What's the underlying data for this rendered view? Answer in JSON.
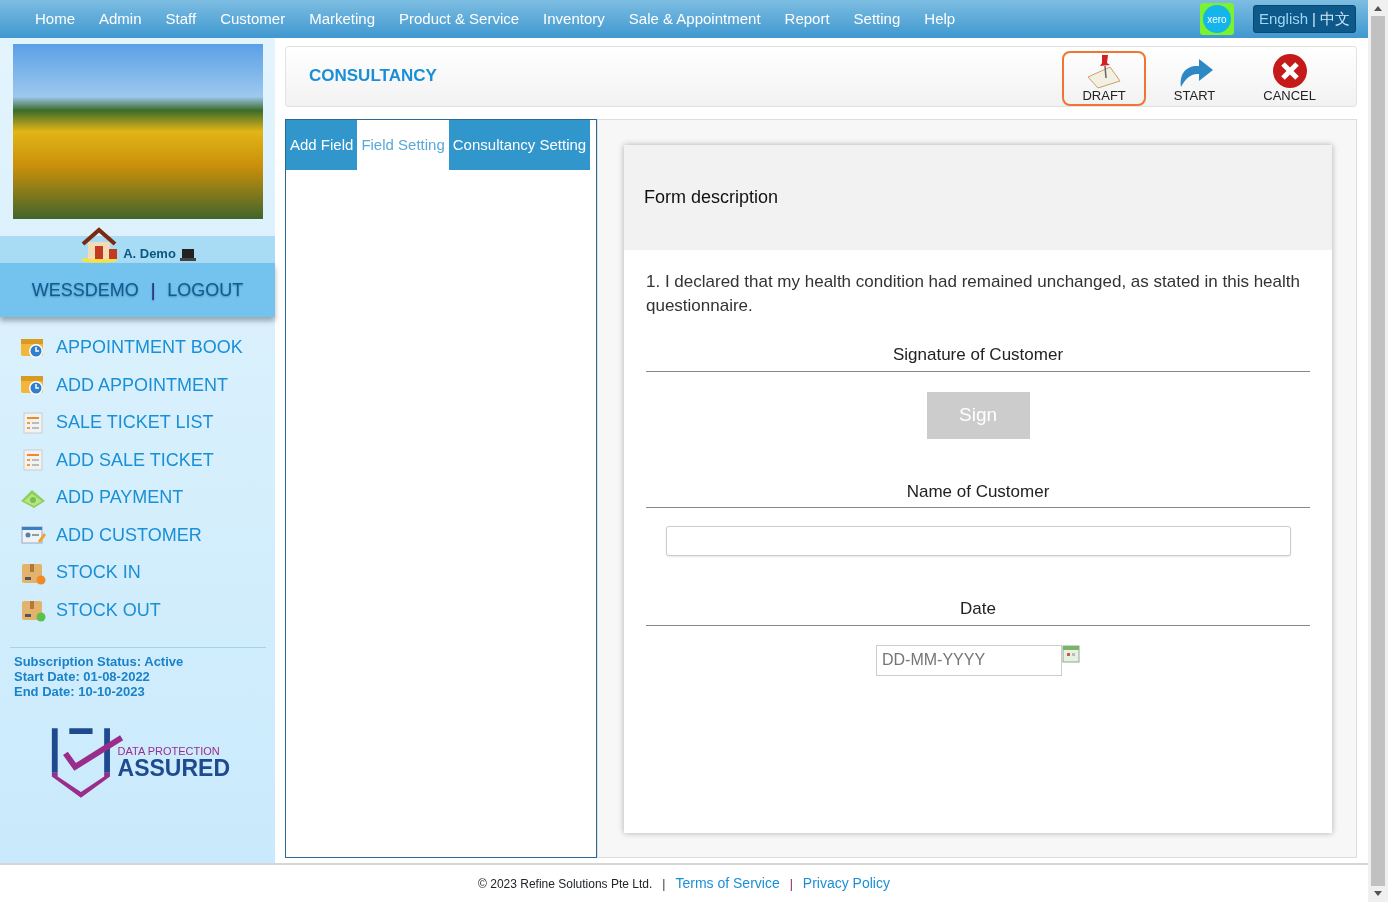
{
  "top_menu": [
    {
      "label": "Home"
    },
    {
      "label": "Admin"
    },
    {
      "label": "Staff"
    },
    {
      "label": "Customer"
    },
    {
      "label": "Marketing"
    },
    {
      "label": "Product & Service"
    },
    {
      "label": "Inventory"
    },
    {
      "label": "Sale & Appointment"
    },
    {
      "label": "Report"
    },
    {
      "label": "Setting"
    },
    {
      "label": "Help"
    }
  ],
  "xero_badge": "xero",
  "languages": [
    {
      "label": "English",
      "selected": true
    },
    {
      "label": "中文",
      "selected": false
    }
  ],
  "language_separator": "|",
  "user": {
    "name": "A. Demo",
    "company": "WESSDEMO",
    "separator": "|",
    "logout": "LOGOUT"
  },
  "sidebar_items": [
    {
      "label": "APPOINTMENT BOOK",
      "kind": "appointment"
    },
    {
      "label": "ADD APPOINTMENT",
      "kind": "appointment"
    },
    {
      "label": "SALE TICKET LIST",
      "kind": "ticket"
    },
    {
      "label": "ADD SALE TICKET",
      "kind": "ticket"
    },
    {
      "label": "ADD PAYMENT",
      "kind": "payment"
    },
    {
      "label": "ADD CUSTOMER",
      "kind": "customer"
    },
    {
      "label": "STOCK IN",
      "kind": "stock_in"
    },
    {
      "label": "STOCK OUT",
      "kind": "stock_out"
    }
  ],
  "subscription": [
    "Subscription Status: Active",
    "Start Date: 01-08-2022",
    "End Date: 10-10-2023"
  ],
  "badge": {
    "line1": "DATA PROTECTION",
    "line2": "ASSURED"
  },
  "page_title": "CONSULTANCY",
  "toolbar": [
    {
      "label": "DRAFT",
      "kind": "draft",
      "focused": true
    },
    {
      "label": "START",
      "kind": "start",
      "focused": false
    },
    {
      "label": "CANCEL",
      "kind": "cancel",
      "focused": false
    }
  ],
  "tabs": [
    {
      "label": "Add Field",
      "selected": false
    },
    {
      "label": "Field Setting",
      "selected": true
    },
    {
      "label": "Consultancy Setting",
      "selected": false
    }
  ],
  "form": {
    "description": "Form description",
    "question": "1.  I declared that my health condition had remained unchanged, as stated in this health questionnaire.",
    "fields": [
      {
        "label": "Signature of Customer",
        "kind": "signature",
        "button": "Sign",
        "disabled": true
      },
      {
        "label": "Name of Customer",
        "kind": "text"
      },
      {
        "label": "Date",
        "kind": "date",
        "placeholder": "DD-MM-YYYY"
      }
    ]
  },
  "footer": {
    "copyright": "© 2023 Refine Solutions Pte Ltd.",
    "separator": "|",
    "links": [
      "Terms of Service",
      "Privacy Policy"
    ]
  }
}
